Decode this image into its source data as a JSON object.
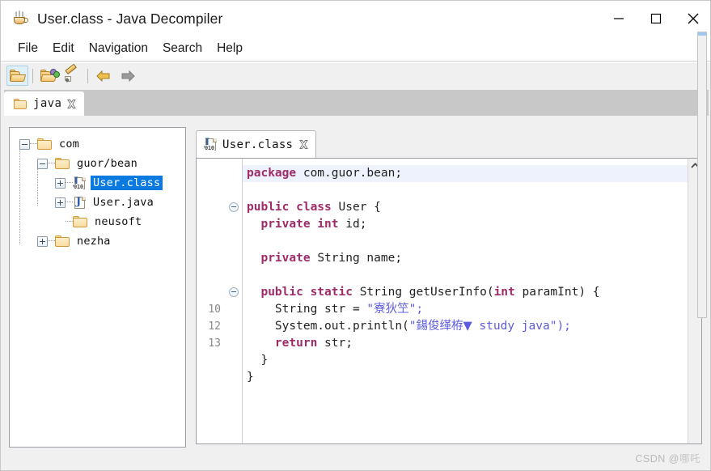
{
  "window": {
    "title": "User.class - Java Decompiler",
    "icon": "java-cup-icon",
    "controls": {
      "minimize": "minimize-icon",
      "maximize": "maximize-icon",
      "close": "close-icon"
    }
  },
  "menubar": {
    "items": [
      {
        "label": "File"
      },
      {
        "label": "Edit"
      },
      {
        "label": "Navigation"
      },
      {
        "label": "Search"
      },
      {
        "label": "Help"
      }
    ]
  },
  "toolbar": {
    "buttons": [
      {
        "name": "open-file-button",
        "icon": "folder-open-icon",
        "active": true
      },
      {
        "name": "open-type-button",
        "icon": "folder-open-colored-icon",
        "active": false
      },
      {
        "name": "decompile-button",
        "icon": "pen-icon",
        "active": false
      },
      {
        "name": "back-button",
        "icon": "arrow-left-icon",
        "active": false
      },
      {
        "name": "forward-button",
        "icon": "arrow-right-icon",
        "active": false
      }
    ]
  },
  "view_tabs": [
    {
      "label": "java",
      "icon": "folder-icon",
      "closable": true,
      "active": true
    }
  ],
  "tree": {
    "nodes": [
      {
        "label": "com",
        "depth": 0,
        "expander": "minus",
        "icon": "folder-open-icon"
      },
      {
        "label": "guor/bean",
        "depth": 1,
        "expander": "minus",
        "icon": "folder-open-icon"
      },
      {
        "label": "User.class",
        "depth": 2,
        "expander": "plus",
        "icon": "class-file-icon",
        "selected": true
      },
      {
        "label": "User.java",
        "depth": 2,
        "expander": "plus",
        "icon": "java-file-icon",
        "selected": false
      },
      {
        "label": "neusoft",
        "depth": 2,
        "expander": "none",
        "icon": "folder-icon"
      },
      {
        "label": "nezha",
        "depth": 1,
        "expander": "plus",
        "icon": "folder-icon"
      }
    ]
  },
  "editor": {
    "tabs": [
      {
        "label": "User.class",
        "icon": "class-file-icon",
        "closable": true,
        "active": true
      }
    ],
    "lines": [
      {
        "number": "",
        "fold": false,
        "highlight": true,
        "tokens": [
          {
            "text": "package ",
            "style": "kw"
          },
          {
            "text": "com.guor.bean;",
            "style": "plain"
          }
        ]
      },
      {
        "number": "",
        "fold": false,
        "highlight": false,
        "tokens": [
          {
            "text": "",
            "style": "plain"
          }
        ]
      },
      {
        "number": "",
        "fold": true,
        "highlight": false,
        "tokens": [
          {
            "text": "public class ",
            "style": "kw"
          },
          {
            "text": "User {",
            "style": "plain"
          }
        ]
      },
      {
        "number": "",
        "fold": false,
        "highlight": false,
        "tokens": [
          {
            "text": "  ",
            "style": "plain"
          },
          {
            "text": "private int ",
            "style": "kw"
          },
          {
            "text": "id;",
            "style": "plain"
          }
        ]
      },
      {
        "number": "",
        "fold": false,
        "highlight": false,
        "tokens": [
          {
            "text": "",
            "style": "plain"
          }
        ]
      },
      {
        "number": "",
        "fold": false,
        "highlight": false,
        "tokens": [
          {
            "text": "  ",
            "style": "plain"
          },
          {
            "text": "private ",
            "style": "kw"
          },
          {
            "text": "String name;",
            "style": "plain"
          }
        ]
      },
      {
        "number": "",
        "fold": false,
        "highlight": false,
        "tokens": [
          {
            "text": "",
            "style": "plain"
          }
        ]
      },
      {
        "number": "",
        "fold": true,
        "highlight": false,
        "tokens": [
          {
            "text": "  ",
            "style": "plain"
          },
          {
            "text": "public static ",
            "style": "kw"
          },
          {
            "text": "String getUserInfo(",
            "style": "plain"
          },
          {
            "text": "int ",
            "style": "kw"
          },
          {
            "text": "paramInt) {",
            "style": "plain"
          }
        ]
      },
      {
        "number": "10",
        "fold": false,
        "highlight": false,
        "tokens": [
          {
            "text": "    String str = ",
            "style": "plain"
          },
          {
            "text": "\"",
            "style": "str"
          },
          {
            "text": "寮狄笁",
            "style": "cjk"
          },
          {
            "text": "\";",
            "style": "str"
          }
        ]
      },
      {
        "number": "12",
        "fold": false,
        "highlight": false,
        "tokens": [
          {
            "text": "    System.out.println(",
            "style": "plain"
          },
          {
            "text": "\"",
            "style": "str"
          },
          {
            "text": "鍚俊缂栫▼",
            "style": "cjk"
          },
          {
            "text": " study java\");",
            "style": "str"
          }
        ]
      },
      {
        "number": "13",
        "fold": false,
        "highlight": false,
        "tokens": [
          {
            "text": "    ",
            "style": "plain"
          },
          {
            "text": "return ",
            "style": "kw"
          },
          {
            "text": "str;",
            "style": "plain"
          }
        ]
      },
      {
        "number": "",
        "fold": false,
        "highlight": false,
        "tokens": [
          {
            "text": "  }",
            "style": "plain"
          }
        ]
      },
      {
        "number": "",
        "fold": false,
        "highlight": false,
        "tokens": [
          {
            "text": "}",
            "style": "plain"
          }
        ]
      }
    ],
    "scroll": {
      "up_arrow": "chevron-up-icon"
    }
  },
  "watermark": {
    "prefix": "CSDN @",
    "handle": "哪吒"
  },
  "colors": {
    "selection": "#0a7ae0",
    "keyword": "#9f2b68",
    "string": "#5c5ce0",
    "line_highlight": "#eef2fc",
    "panel_border": "#9aa0a6",
    "tabstrip_bg": "#c8c8c8"
  }
}
